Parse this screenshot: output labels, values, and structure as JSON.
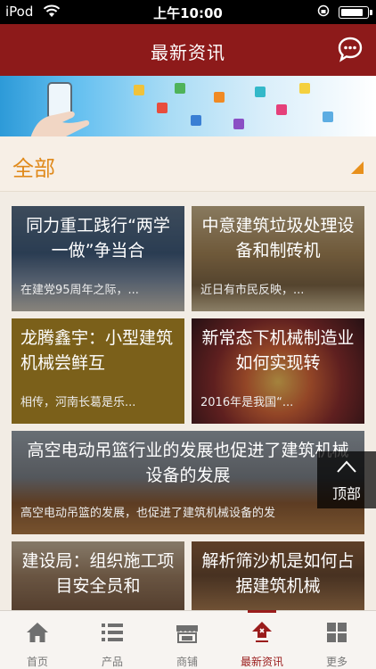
{
  "status_bar": {
    "carrier": "iPod",
    "time": "上午10:00"
  },
  "nav": {
    "title": "最新资讯",
    "chat_icon": "speech-bubble-icon"
  },
  "filter": {
    "label": "全部",
    "dropdown_icon": "triangle-corner-icon"
  },
  "articles": [
    {
      "title": "同力重工践行“两学一做”争当合",
      "summary": "在建党95周年之际，..."
    },
    {
      "title": "中意建筑垃圾处理设备和制砖机",
      "summary": "近日有市民反映，..."
    },
    {
      "title": "龙腾鑫宇：小型建筑机械尝鲜互",
      "summary": "相传，河南长葛是乐..."
    },
    {
      "title": "新常态下机械制造业如何实现转",
      "summary": "2016年是我国“..."
    },
    {
      "title": "高空电动吊篮行业的发展也促进了建筑机械设备的发展",
      "summary": "高空电动吊篮的发展，也促进了建筑机械设备的发"
    },
    {
      "title": "建设局：组织施工项目安全员和",
      "summary": ""
    },
    {
      "title": "解析筛沙机是如何占据建筑机械",
      "summary": ""
    }
  ],
  "back_to_top": {
    "label": "顶部"
  },
  "tabs": [
    {
      "label": "首页",
      "icon": "home-icon"
    },
    {
      "label": "产品",
      "icon": "list-icon"
    },
    {
      "label": "商铺",
      "icon": "shop-icon"
    },
    {
      "label": "最新资讯",
      "icon": "news-icon",
      "active": true
    },
    {
      "label": "更多",
      "icon": "grid-icon"
    }
  ],
  "colors": {
    "brand": "#8d1a1a",
    "accent": "#e8901c",
    "tab_active": "#9a1c1c"
  }
}
